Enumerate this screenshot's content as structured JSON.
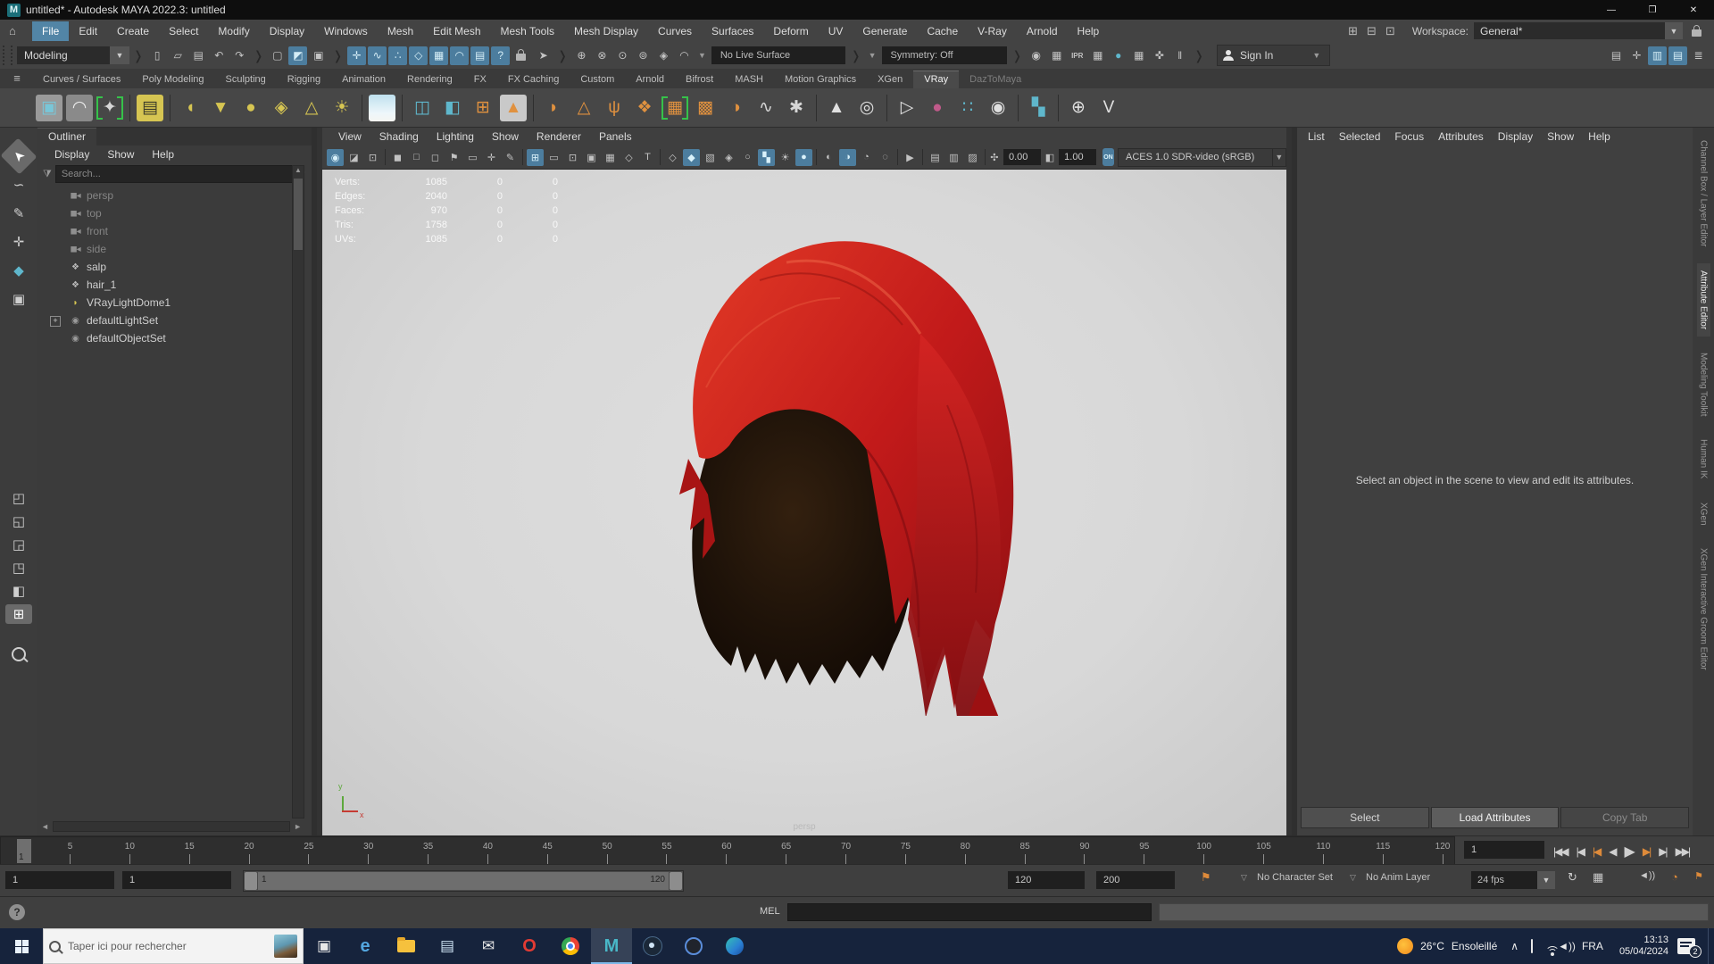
{
  "window": {
    "title": "untitled* - Autodesk MAYA 2022.3: untitled",
    "app_initial": "M",
    "controls": {
      "minimize": "—",
      "restore": "❐",
      "close": "✕"
    }
  },
  "menubar": {
    "items": [
      "File",
      "Edit",
      "Create",
      "Select",
      "Modify",
      "Display",
      "Windows",
      "Mesh",
      "Edit Mesh",
      "Mesh Tools",
      "Mesh Display",
      "Curves",
      "Surfaces",
      "Deform",
      "UV",
      "Generate",
      "Cache",
      "V-Ray",
      "Arnold",
      "Help"
    ],
    "active": "File",
    "home_glyph": "⌂",
    "workspace_icons": [
      {
        "n": "workspace-panes-icon",
        "g": "⊞"
      },
      {
        "n": "workspace-rows-icon",
        "g": "⊟"
      },
      {
        "n": "workspace-layout-icon",
        "g": "⊡"
      }
    ],
    "workspace_label": "Workspace:",
    "workspace_value": "General*",
    "dropdown_glyph": "▼"
  },
  "statusline": {
    "mode": "Modeling",
    "file_icons": [
      {
        "n": "new-scene-button",
        "g": "▯"
      },
      {
        "n": "open-scene-button",
        "g": "▱"
      },
      {
        "n": "save-scene-button",
        "g": "▤"
      },
      {
        "n": "undo-button",
        "g": "↶"
      },
      {
        "n": "redo-button",
        "g": "↷"
      }
    ],
    "selection_icons": [
      {
        "n": "select-hierarchy-button",
        "g": "▢"
      },
      {
        "n": "select-object-button",
        "g": "◩",
        "a": 1
      },
      {
        "n": "select-component-button",
        "g": "▣"
      }
    ],
    "snap_icons": [
      {
        "n": "snap-grid-button",
        "g": "✛",
        "a": 1
      },
      {
        "n": "snap-curve-button",
        "g": "∿",
        "a": 1
      },
      {
        "n": "snap-point-button",
        "g": "∴",
        "a": 1
      },
      {
        "n": "snap-projected-center-button",
        "g": "◇",
        "a": 1
      },
      {
        "n": "snap-viewplane-button",
        "g": "▦",
        "a": 1
      },
      {
        "n": "make-live-button",
        "g": "◠",
        "a": 1
      },
      {
        "n": "film-snap-button",
        "g": "▤",
        "a": 1
      },
      {
        "n": "snap-help-button",
        "g": "?",
        "a": 1
      }
    ],
    "lock_icons": [
      {
        "n": "lock-selection-icon",
        "g": "lock"
      },
      {
        "n": "highlight-selection-button",
        "g": "➤"
      }
    ],
    "construction_icons": [
      {
        "n": "construction-history-button",
        "g": "⊕"
      },
      {
        "n": "construction-curve-button",
        "g": "⊗"
      },
      {
        "n": "construction-point-button",
        "g": "⊙"
      },
      {
        "n": "construction-axis-button",
        "g": "⊚"
      },
      {
        "n": "construction-plane-button",
        "g": "◈"
      },
      {
        "n": "construction-magnet-button",
        "g": "◠"
      }
    ],
    "no_live_surface": "No Live Surface",
    "symmetry": "Symmetry: Off",
    "render_icons": [
      {
        "n": "render-view-button",
        "g": "◉"
      },
      {
        "n": "render-current-frame-button",
        "g": "▦"
      },
      {
        "n": "ipr-render-button",
        "g": "IPR",
        "txt": 1
      },
      {
        "n": "render-sequence-button",
        "g": "▦"
      },
      {
        "n": "hypershade-button",
        "g": "●",
        "c": "#5fb7cc"
      },
      {
        "n": "render-settings-button",
        "g": "▦"
      },
      {
        "n": "light-editor-button",
        "g": "✜"
      },
      {
        "n": "pause-button",
        "g": "‖"
      }
    ],
    "sign_in": "Sign In",
    "right_icons": [
      {
        "n": "modeling-toolkit-toggle",
        "g": "▤"
      },
      {
        "n": "character-controls-toggle",
        "g": "✛"
      },
      {
        "n": "channel-box-toggle",
        "g": "▥",
        "a": 1
      },
      {
        "n": "attribute-editor-toggle",
        "g": "▤",
        "a": 1
      },
      {
        "n": "tool-settings-toggle",
        "g": "≣"
      }
    ]
  },
  "shelf": {
    "tabs": [
      "Curves / Surfaces",
      "Poly Modeling",
      "Sculpting",
      "Rigging",
      "Animation",
      "Rendering",
      "FX",
      "FX Caching",
      "Custom",
      "Arnold",
      "Bifrost",
      "MASH",
      "Motion Graphics",
      "XGen",
      "VRay",
      "DazToMaya"
    ],
    "active_tab": "VRay",
    "dim_tab": "DazToMaya",
    "hamburger_glyph": "≡",
    "gear_glyph": "✱",
    "icons": [
      {
        "n": "vray-render-icon",
        "g": "▣",
        "c": "#79c6d8",
        "bp": "#9a9a9a"
      },
      {
        "n": "vray-dome-icon",
        "g": "◠",
        "c": "#ececec",
        "bp": "#8a8a8a"
      },
      {
        "n": "vray-frame-buffer-icon",
        "g": "✦",
        "c": "#d6d6d6",
        "brk": "#36c24a"
      },
      {
        "sep": 1
      },
      {
        "n": "vray-light-lister-icon",
        "g": "▤",
        "c": "#3a3a2a",
        "bp": "#d6c552"
      },
      {
        "sep": 1
      },
      {
        "n": "vray-dome-light-icon",
        "g": "◖",
        "c": "#d6c552"
      },
      {
        "n": "vray-rect-light-icon",
        "g": "▼",
        "c": "#d6c552"
      },
      {
        "n": "vray-sphere-light-icon",
        "g": "●",
        "c": "#d6c552"
      },
      {
        "n": "vray-geo-light-icon",
        "g": "◈",
        "c": "#d6c552"
      },
      {
        "n": "vray-mesh-light-icon",
        "g": "△",
        "c": "#d6c552"
      },
      {
        "n": "vray-sun-light-icon",
        "g": "☀",
        "c": "#d6c552"
      },
      {
        "sep": 1
      },
      {
        "n": "vray-sky-icon",
        "g": "",
        "c": "#ffffff",
        "bp": "sky"
      },
      {
        "sep": 1
      },
      {
        "n": "vray-proxy-export-icon",
        "g": "◫",
        "c": "#5fb7cc"
      },
      {
        "n": "vray-proxy-import-icon",
        "g": "◧",
        "c": "#5fb7cc"
      },
      {
        "n": "vray-mesh-to-proxy-icon",
        "g": "⊞",
        "c": "#e0913f"
      },
      {
        "n": "vray-volume-grid-icon",
        "g": "▲",
        "c": "#e0913f",
        "bp": "#c9c9c9"
      },
      {
        "sep": 1
      },
      {
        "n": "vray-fur-icon",
        "g": "◗",
        "c": "#e0913f"
      },
      {
        "n": "vray-displacement-icon",
        "g": "△",
        "c": "#e0913f"
      },
      {
        "n": "vray-grass-icon",
        "g": "ψ",
        "c": "#e0913f"
      },
      {
        "n": "vray-scatter-icon",
        "g": "❖",
        "c": "#e0913f"
      },
      {
        "n": "vray-cloth-icon",
        "g": "▦",
        "c": "#e0913f",
        "brk": "#36c24a"
      },
      {
        "n": "vray-cluster-icon",
        "g": "▩",
        "c": "#e0913f"
      },
      {
        "n": "vray-hair-icon",
        "g": "◑",
        "c": "#e0913f"
      },
      {
        "n": "vray-spline-icon",
        "g": "∿",
        "c": "#d6d6d6"
      },
      {
        "n": "vray-settings-icon",
        "g": "✱",
        "c": "#d6d6d6"
      },
      {
        "sep": 1
      },
      {
        "n": "vray-cone-objects-icon",
        "g": "▲",
        "c": "#e0e0e0"
      },
      {
        "n": "vray-sphere-objects-icon",
        "g": "◎",
        "c": "#e0e0e0"
      },
      {
        "sep": 1
      },
      {
        "n": "vray-page-arrow-icon",
        "g": "▷",
        "c": "#e0e0e0"
      },
      {
        "n": "vray-color-sphere-icon",
        "g": "●",
        "c": "#c05a8a"
      },
      {
        "n": "vray-dots-icon",
        "g": "∷",
        "c": "#5fb7cc"
      },
      {
        "n": "vray-palette-icon",
        "g": "◉",
        "c": "#e0e0e0"
      },
      {
        "sep": 1
      },
      {
        "n": "vray-checker-icon",
        "g": "▚",
        "c": "#5fb7cc"
      },
      {
        "sep": 1
      },
      {
        "n": "vray-plug-icon",
        "g": "⊕",
        "c": "#e0e0e0"
      },
      {
        "n": "vray-logo-icon",
        "g": "V",
        "c": "#e0e0e0"
      }
    ]
  },
  "toolbox": {
    "tools": [
      {
        "n": "select-tool",
        "g": "➤",
        "a": 1,
        "rot": -135
      },
      {
        "n": "lasso-tool",
        "g": "∽"
      },
      {
        "n": "paint-selection-tool",
        "g": "✎"
      },
      {
        "n": "move-tool",
        "g": "✛"
      },
      {
        "n": "rotate-tool",
        "g": "◆",
        "c": "#5fb7cc"
      },
      {
        "n": "scale-tool",
        "g": "▣"
      }
    ],
    "layouts": [
      {
        "n": "layout-single-pane",
        "g": "◰"
      },
      {
        "n": "layout-two-pane",
        "g": "◱"
      },
      {
        "n": "layout-three-pane",
        "g": "◲"
      },
      {
        "n": "layout-four-pane",
        "g": "◳"
      },
      {
        "n": "layout-outliner-persp",
        "g": "◧"
      },
      {
        "n": "layout-current",
        "g": "⊞",
        "a": 1
      }
    ]
  },
  "outliner": {
    "title": "Outliner",
    "menus": [
      "Display",
      "Show",
      "Help"
    ],
    "search_placeholder": "Search...",
    "items": [
      {
        "label": "persp",
        "icon": "camera",
        "dim": 1
      },
      {
        "label": "top",
        "icon": "camera",
        "dim": 1
      },
      {
        "label": "front",
        "icon": "camera",
        "dim": 1
      },
      {
        "label": "side",
        "icon": "camera",
        "dim": 1
      },
      {
        "label": "salp",
        "icon": "mesh"
      },
      {
        "label": "hair_1",
        "icon": "mesh"
      },
      {
        "label": "VRayLightDome1",
        "icon": "domelight"
      },
      {
        "label": "defaultLightSet",
        "icon": "set",
        "expandable": 1
      },
      {
        "label": "defaultObjectSet",
        "icon": "set"
      }
    ]
  },
  "viewport": {
    "menus": [
      "View",
      "Shading",
      "Lighting",
      "Show",
      "Renderer",
      "Panels"
    ],
    "icons": [
      {
        "n": "selected-mode-icon",
        "g": "◉",
        "a": 1
      },
      {
        "n": "display-mode-icon",
        "g": "◪"
      },
      {
        "n": "viewcube-icon",
        "g": "⊡"
      },
      {
        "sep": 1
      },
      {
        "n": "select-camera-icon",
        "g": "◼"
      },
      {
        "n": "lock-camera-icon",
        "g": "□"
      },
      {
        "n": "camera-attributes-icon",
        "g": "◻"
      },
      {
        "n": "bookmark-icon",
        "g": "⚑"
      },
      {
        "n": "image-plane-icon",
        "g": "▭"
      },
      {
        "n": "pivot-icon",
        "g": "✛"
      },
      {
        "n": "pencil-icon",
        "g": "✎"
      },
      {
        "sep": 1
      },
      {
        "n": "grid-icon",
        "g": "⊞",
        "a": 1
      },
      {
        "n": "film-gate-icon",
        "g": "▭"
      },
      {
        "n": "resolution-gate-icon",
        "g": "⊡"
      },
      {
        "n": "gate-mask-icon",
        "g": "▣"
      },
      {
        "n": "field-chart-icon",
        "g": "▦"
      },
      {
        "n": "safe-action-icon",
        "g": "◇"
      },
      {
        "n": "safe-title-icon",
        "g": "T"
      },
      {
        "sep": 1
      },
      {
        "n": "wireframe-icon",
        "g": "◇"
      },
      {
        "n": "smooth-shade-icon",
        "g": "◆",
        "a": 1
      },
      {
        "n": "textured-icon",
        "g": "▧"
      },
      {
        "n": "wireframe-on-shaded-icon",
        "g": "◈"
      },
      {
        "n": "default-material-icon",
        "g": "○"
      },
      {
        "n": "checkered-icon",
        "g": "▚",
        "a": 1
      },
      {
        "n": "lights-icon",
        "g": "☀"
      },
      {
        "n": "shadows-icon",
        "g": "●",
        "a": 1
      },
      {
        "sep": 1
      },
      {
        "n": "ao-icon",
        "g": "◐"
      },
      {
        "n": "anti-alias-icon",
        "g": "◑",
        "a": 1
      },
      {
        "n": "motion-blur-icon",
        "g": "◔"
      },
      {
        "n": "exposure-icon",
        "g": "◌"
      },
      {
        "sep": 1
      },
      {
        "n": "isolate-select-icon",
        "g": "▶"
      },
      {
        "sep": 1
      },
      {
        "n": "copy-view-icon",
        "g": "▤"
      },
      {
        "n": "paste-view-icon",
        "g": "▥"
      },
      {
        "n": "xray-icon",
        "g": "▨"
      }
    ],
    "exposure": "0.00",
    "gamma": "1.00",
    "exposure_glyph": "✣",
    "gamma_glyph": "◧",
    "colorspace_toggle": "ON",
    "colorspace": "ACES 1.0 SDR-video (sRGB)",
    "hud": {
      "rows": [
        {
          "label": "Verts:",
          "v1": "1085",
          "v2": "0",
          "v3": "0"
        },
        {
          "label": "Edges:",
          "v1": "2040",
          "v2": "0",
          "v3": "0"
        },
        {
          "label": "Faces:",
          "v1": "970",
          "v2": "0",
          "v3": "0"
        },
        {
          "label": "Tris:",
          "v1": "1758",
          "v2": "0",
          "v3": "0"
        },
        {
          "label": "UVs:",
          "v1": "1085",
          "v2": "0",
          "v3": "0"
        }
      ]
    },
    "camera_label": "persp",
    "axis_x": "x",
    "axis_y": "y"
  },
  "attribute_editor": {
    "menus": [
      "List",
      "Selected",
      "Focus",
      "Attributes",
      "Display",
      "Show",
      "Help"
    ],
    "hint": "Select an object in the scene to view and edit its attributes.",
    "buttons": [
      "Select",
      "Load Attributes",
      "Copy Tab"
    ],
    "lit_button": "Load Attributes",
    "dim_button": "Copy Tab"
  },
  "right_tabs": {
    "items": [
      "Channel Box / Layer Editor",
      "Attribute Editor",
      "Modeling Toolkit",
      "Human IK",
      "XGen",
      "XGen Interactive Groom Editor"
    ],
    "active": "Attribute Editor"
  },
  "timeline": {
    "ticks": [
      5,
      10,
      15,
      20,
      25,
      30,
      35,
      40,
      45,
      50,
      55,
      60,
      65,
      70,
      75,
      80,
      85,
      90,
      95,
      100,
      105,
      110,
      115,
      120
    ],
    "current_frame": "1",
    "current_frame_field": "1",
    "playback": [
      {
        "n": "go-to-start-button",
        "g": "|◀◀"
      },
      {
        "n": "step-back-button",
        "g": "|◀"
      },
      {
        "n": "prev-key-button",
        "g": "|◀",
        "key": 1
      },
      {
        "n": "play-backwards-button",
        "g": "◀"
      },
      {
        "n": "play-button",
        "g": "▶",
        "big": 1
      },
      {
        "n": "next-key-button",
        "g": "▶|",
        "key": 1
      },
      {
        "n": "step-forward-button",
        "g": "▶|"
      },
      {
        "n": "go-to-end-button",
        "g": "▶▶|"
      }
    ]
  },
  "range": {
    "anim_start": "1",
    "play_start": "1",
    "bar_start": "1",
    "bar_end": "120",
    "play_end": "120",
    "anim_end": "200",
    "bookmark_glyph": "⚑",
    "character_set": "No Character Set",
    "anim_layer": "No Anim Layer",
    "fps": "24 fps",
    "loop_glyph": "↻",
    "clip_glyph": "▦",
    "volume_glyph": "◄))",
    "autokey_glyph": "◔",
    "prefs_glyph": "⚑"
  },
  "command_line": {
    "help_glyph": "?",
    "mel_label": "MEL"
  },
  "taskbar": {
    "search_placeholder": "Taper ici pour rechercher",
    "icons": [
      {
        "n": "task-view-button",
        "g": "▣"
      },
      {
        "n": "edge-legacy-icon",
        "g": "e",
        "c": "#53a7e0",
        "big": 1
      },
      {
        "n": "file-explorer-icon",
        "art": "folder"
      },
      {
        "n": "microsoft-store-icon",
        "g": "▤",
        "c": "#cfe4f5"
      },
      {
        "n": "mail-icon",
        "g": "✉",
        "c": "#eaeaea"
      },
      {
        "n": "opera-icon",
        "g": "O",
        "c": "#e23b34",
        "big": 1
      },
      {
        "n": "chrome-icon",
        "art": "chrome"
      },
      {
        "n": "maya-taskbar-icon",
        "g": "M",
        "c": "#49b8c8",
        "big": 1,
        "active": 1
      },
      {
        "n": "steam-icon",
        "art": "steam"
      },
      {
        "n": "app-icon",
        "art": "darkapp"
      },
      {
        "n": "edge-icon",
        "art": "edgec"
      }
    ],
    "temperature": "26°C",
    "weather": "Ensoleillé",
    "chevron": "∧",
    "language": "FRA",
    "time": "13:13",
    "date": "05/04/2024",
    "notification_count": "2"
  },
  "colors": {
    "accent_blue": "#4c7d9e",
    "viewport_bg": "#d9d9d9",
    "hair_red": "#c21a1a",
    "light_yellow": "#d6c552",
    "taskbar_bg": "#16233c"
  }
}
